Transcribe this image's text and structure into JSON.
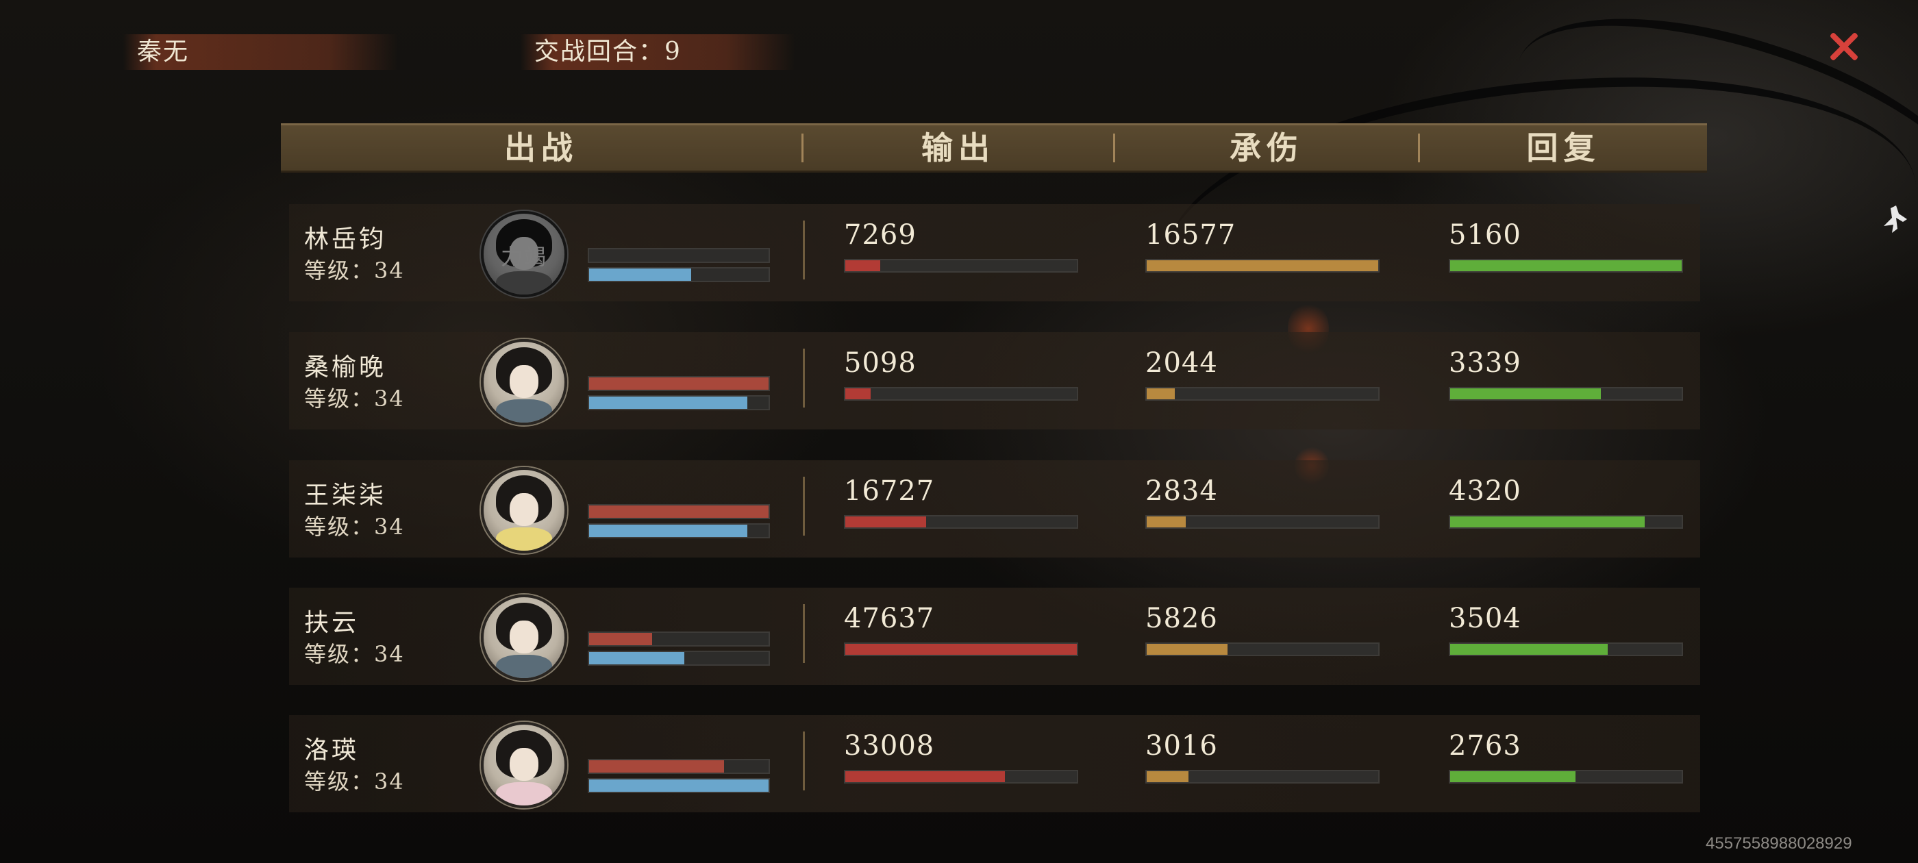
{
  "top": {
    "player_name": "秦无",
    "round_text": "交战回合：9"
  },
  "header": [
    "出战",
    "输出",
    "承伤",
    "回复"
  ],
  "colors": {
    "output": "#b23b35",
    "damage_taken": "#b8893f",
    "heal": "#5fae3a",
    "mini_red": "#a8483b",
    "mini_blue": "#6aa6cc"
  },
  "rows": [
    {
      "name": "林岳钧",
      "level": "等级：34",
      "avatar_text": "力竭",
      "avatar_icon": "portrait-male-exhausted",
      "hp_fraction": 0.0,
      "mp_fraction": 0.57,
      "output": "7269",
      "output_fraction": 0.15,
      "damage_taken": "16577",
      "damage_taken_fraction": 1.0,
      "heal": "5160",
      "heal_fraction": 1.0
    },
    {
      "name": "桑榆晚",
      "level": "等级：34",
      "avatar_text": "",
      "avatar_icon": "portrait-female",
      "hp_fraction": 1.0,
      "mp_fraction": 0.88,
      "output": "5098",
      "output_fraction": 0.11,
      "damage_taken": "2044",
      "damage_taken_fraction": 0.12,
      "heal": "3339",
      "heal_fraction": 0.65
    },
    {
      "name": "王柒柒",
      "level": "等级：34",
      "avatar_text": "",
      "avatar_icon": "portrait-female-flower",
      "hp_fraction": 1.0,
      "mp_fraction": 0.88,
      "output": "16727",
      "output_fraction": 0.35,
      "damage_taken": "2834",
      "damage_taken_fraction": 0.17,
      "heal": "4320",
      "heal_fraction": 0.84
    },
    {
      "name": "扶云",
      "level": "等级：34",
      "avatar_text": "",
      "avatar_icon": "portrait-male",
      "hp_fraction": 0.35,
      "mp_fraction": 0.53,
      "output": "47637",
      "output_fraction": 1.0,
      "damage_taken": "5826",
      "damage_taken_fraction": 0.35,
      "heal": "3504",
      "heal_fraction": 0.68
    },
    {
      "name": "洛瑛",
      "level": "等级：34",
      "avatar_text": "",
      "avatar_icon": "portrait-female-pink",
      "hp_fraction": 0.75,
      "mp_fraction": 1.0,
      "output": "33008",
      "output_fraction": 0.69,
      "damage_taken": "3016",
      "damage_taken_fraction": 0.18,
      "heal": "2763",
      "heal_fraction": 0.54
    }
  ],
  "footer_id": "4557558988028929"
}
